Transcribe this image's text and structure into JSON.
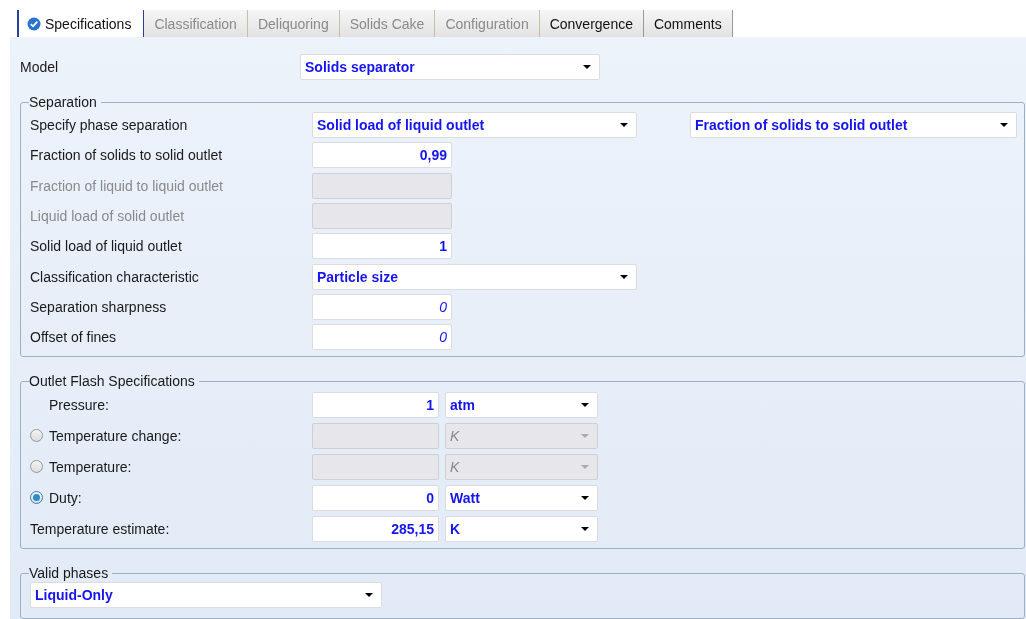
{
  "tabs": [
    {
      "label": "Specifications",
      "selected": true,
      "disabled": false,
      "complete": true
    },
    {
      "label": "Classification",
      "selected": false,
      "disabled": true,
      "complete": false
    },
    {
      "label": "Deliquoring",
      "selected": false,
      "disabled": true,
      "complete": false
    },
    {
      "label": "Solids Cake",
      "selected": false,
      "disabled": true,
      "complete": false
    },
    {
      "label": "Configuration",
      "selected": false,
      "disabled": true,
      "complete": false
    },
    {
      "label": "Convergence",
      "selected": false,
      "disabled": false,
      "complete": false
    },
    {
      "label": "Comments",
      "selected": false,
      "disabled": false,
      "complete": false
    }
  ],
  "model": {
    "label": "Model",
    "value": "Solids separator"
  },
  "separation": {
    "title": "Separation",
    "rows": [
      {
        "kind": "dropdown",
        "label": "Specify phase separation",
        "value": "Solid load of liquid outlet",
        "second_value": "Fraction of solids to solid outlet"
      },
      {
        "kind": "input",
        "label": "Fraction of solids to solid outlet",
        "value": "0,99",
        "disabled": false,
        "default": false
      },
      {
        "kind": "input",
        "label": "Fraction of liquid to liquid outlet",
        "disabled": true,
        "default": false
      },
      {
        "kind": "input",
        "label": "Liquid load of solid outlet",
        "disabled": true,
        "default": false
      },
      {
        "kind": "input",
        "label": "Solid load of liquid outlet",
        "value": "1",
        "disabled": false,
        "default": false
      },
      {
        "kind": "dropdown",
        "label": "Classification characteristic",
        "value": "Particle size"
      },
      {
        "kind": "input",
        "label": "Separation sharpness",
        "value": "0",
        "disabled": false,
        "default": true
      },
      {
        "kind": "input",
        "label": "Offset of fines",
        "value": "0",
        "disabled": false,
        "default": true
      }
    ]
  },
  "outlet_flash": {
    "title": "Outlet Flash Specifications",
    "rows": [
      {
        "kind": "indented",
        "label": "Pressure:",
        "value": "1",
        "unit": "atm",
        "disabled": false
      },
      {
        "kind": "radio",
        "label": "Temperature change:",
        "selected": false,
        "unit": "K",
        "disabled": true
      },
      {
        "kind": "radio",
        "label": "Temperature:",
        "selected": false,
        "unit": "K",
        "disabled": true
      },
      {
        "kind": "radio",
        "label": "Duty:",
        "selected": true,
        "value": "0",
        "unit": "Watt",
        "disabled": false
      },
      {
        "kind": "plain",
        "label": "Temperature estimate:",
        "value": "285,15",
        "unit": "K",
        "disabled": false
      }
    ]
  },
  "valid_phases": {
    "title": "Valid phases",
    "value": "Liquid-Only"
  }
}
